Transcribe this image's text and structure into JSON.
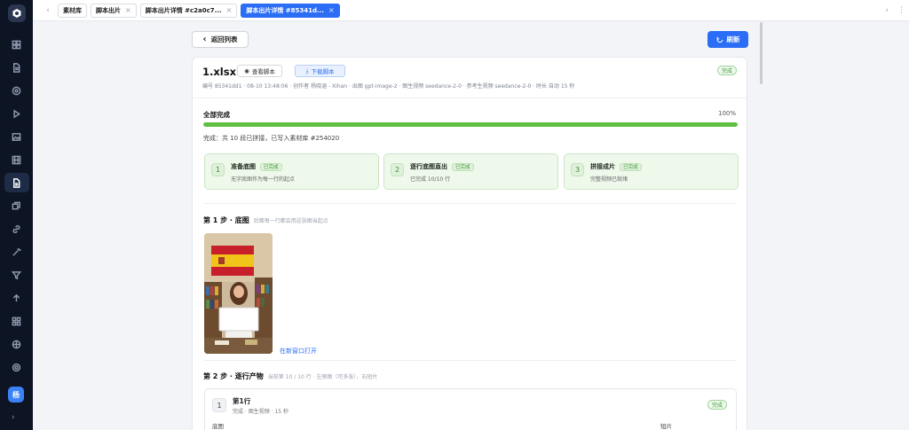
{
  "tabs": [
    {
      "label": "素材库",
      "closable": false,
      "active": false
    },
    {
      "label": "脚本出片",
      "closable": true,
      "active": false
    },
    {
      "label": "脚本出片详情 #c2a0c7...",
      "closable": true,
      "active": false
    },
    {
      "label": "脚本出片详情 #85341d...",
      "closable": true,
      "active": true
    }
  ],
  "toolbar": {
    "back_label": "返回列表",
    "refresh_label": "刷新"
  },
  "job": {
    "filename": "1.xlsx",
    "view_label": "查看脚本",
    "download_label": "下载脚本",
    "status": "完成",
    "meta": "编号 85341dd1 · 08-10 13:48:06 · 创作者 杨晓涵 - Xihan · 出图 gpt-image-2 · 图生视频 seedance-2-0 · 参考生视频 seedance-2-0 · 时长 自动 15 秒"
  },
  "progress": {
    "title": "全部完成",
    "percent_label": "100%",
    "percent": 100,
    "summary": "完成：共 10 段已拼接，已写入素材库 #254020"
  },
  "stages": [
    {
      "num": "1",
      "title": "准备底图",
      "badge": "已完成",
      "desc": "无字底图作为每一行的起点"
    },
    {
      "num": "2",
      "title": "逐行底图直出",
      "badge": "已完成",
      "desc": "已完成 10/10 行"
    },
    {
      "num": "3",
      "title": "拼接成片",
      "badge": "已完成",
      "desc": "完整视频已就绪"
    }
  ],
  "step1": {
    "title": "第 1 步 · 底图",
    "subtitle": "后面每一行都会用这张图当起点",
    "open_link": "在新窗口打开"
  },
  "step2": {
    "title": "第 2 步 · 逐行产物",
    "subtitle": "当前第 10 / 10 行 · 左侧图（可多张），右短片"
  },
  "rows": [
    {
      "num": "1",
      "title": "第1行",
      "desc": "完成 · 图生视频 · 15 秒",
      "status": "完成",
      "col_left": "底图",
      "col_right": "短片"
    }
  ],
  "sidebar": {
    "avatar": "杨"
  },
  "colors": {
    "accent": "#2b6ef5",
    "success": "#5fbf3f",
    "sidebar_bg": "#0d1424"
  }
}
